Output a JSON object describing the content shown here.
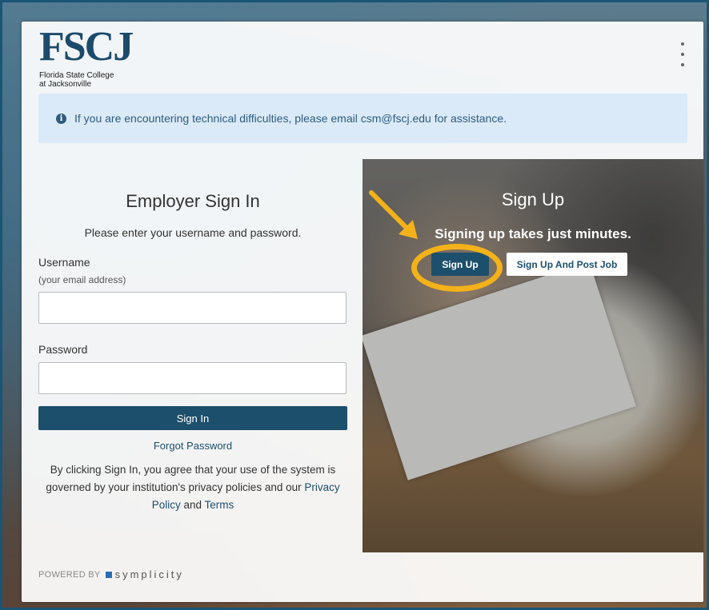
{
  "logo": {
    "mark": "FSCJ",
    "line1": "Florida State College",
    "line2": "at Jacksonville"
  },
  "alert": {
    "text": "If you are encountering technical difficulties, please email csm@fscj.edu for assistance."
  },
  "signin": {
    "title": "Employer Sign In",
    "subtitle": "Please enter your username and password.",
    "username_label": "Username",
    "username_hint": "(your email address)",
    "username_value": "",
    "password_label": "Password",
    "password_value": "",
    "button": "Sign In",
    "forgot": "Forgot Password",
    "terms_prefix": "By clicking Sign In, you agree that your use of the system is governed by your institution's privacy policies and our ",
    "privacy_link": "Privacy Policy",
    "and": " and ",
    "terms_link": "Terms"
  },
  "signup": {
    "title": "Sign Up",
    "subtitle": "Signing up takes just minutes.",
    "button": "Sign Up",
    "post_button": "Sign Up And Post Job"
  },
  "footer": {
    "powered_by": "POWERED BY",
    "brand": "symplicity"
  },
  "colors": {
    "primary": "#1c4f6b",
    "alert_bg": "#dbeaf9",
    "highlight": "#f3b21a"
  }
}
